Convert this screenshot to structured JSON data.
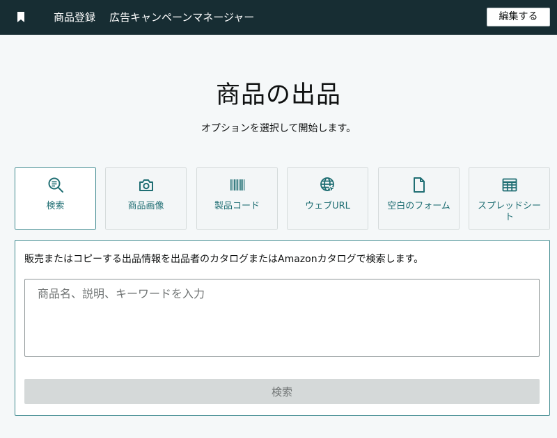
{
  "topbar": {
    "nav": [
      "商品登録",
      "広告キャンペーンマネージャー"
    ],
    "edit_label": "編集する",
    "background": "#172d33"
  },
  "main": {
    "title": "商品の出品",
    "subtitle": "オプションを選択して開始します。"
  },
  "options": [
    {
      "label": "検索",
      "icon": "search-list-icon",
      "selected": true
    },
    {
      "label": "商品画像",
      "icon": "camera-icon",
      "selected": false
    },
    {
      "label": "製品コード",
      "icon": "barcode-icon",
      "selected": false
    },
    {
      "label": "ウェブURL",
      "icon": "globe-cursor-icon",
      "selected": false
    },
    {
      "label": "空白のフォーム",
      "icon": "document-icon",
      "selected": false
    },
    {
      "label": "スプレッドシート",
      "icon": "spreadsheet-icon",
      "selected": false
    }
  ],
  "panel": {
    "description": "販売またはコピーする出品情報を出品者のカタログまたはAmazonカタログで検索します。",
    "search_placeholder": "商品名、説明、キーワードを入力",
    "search_value": "",
    "search_button": "検索",
    "accent": "#3f8a8f"
  }
}
